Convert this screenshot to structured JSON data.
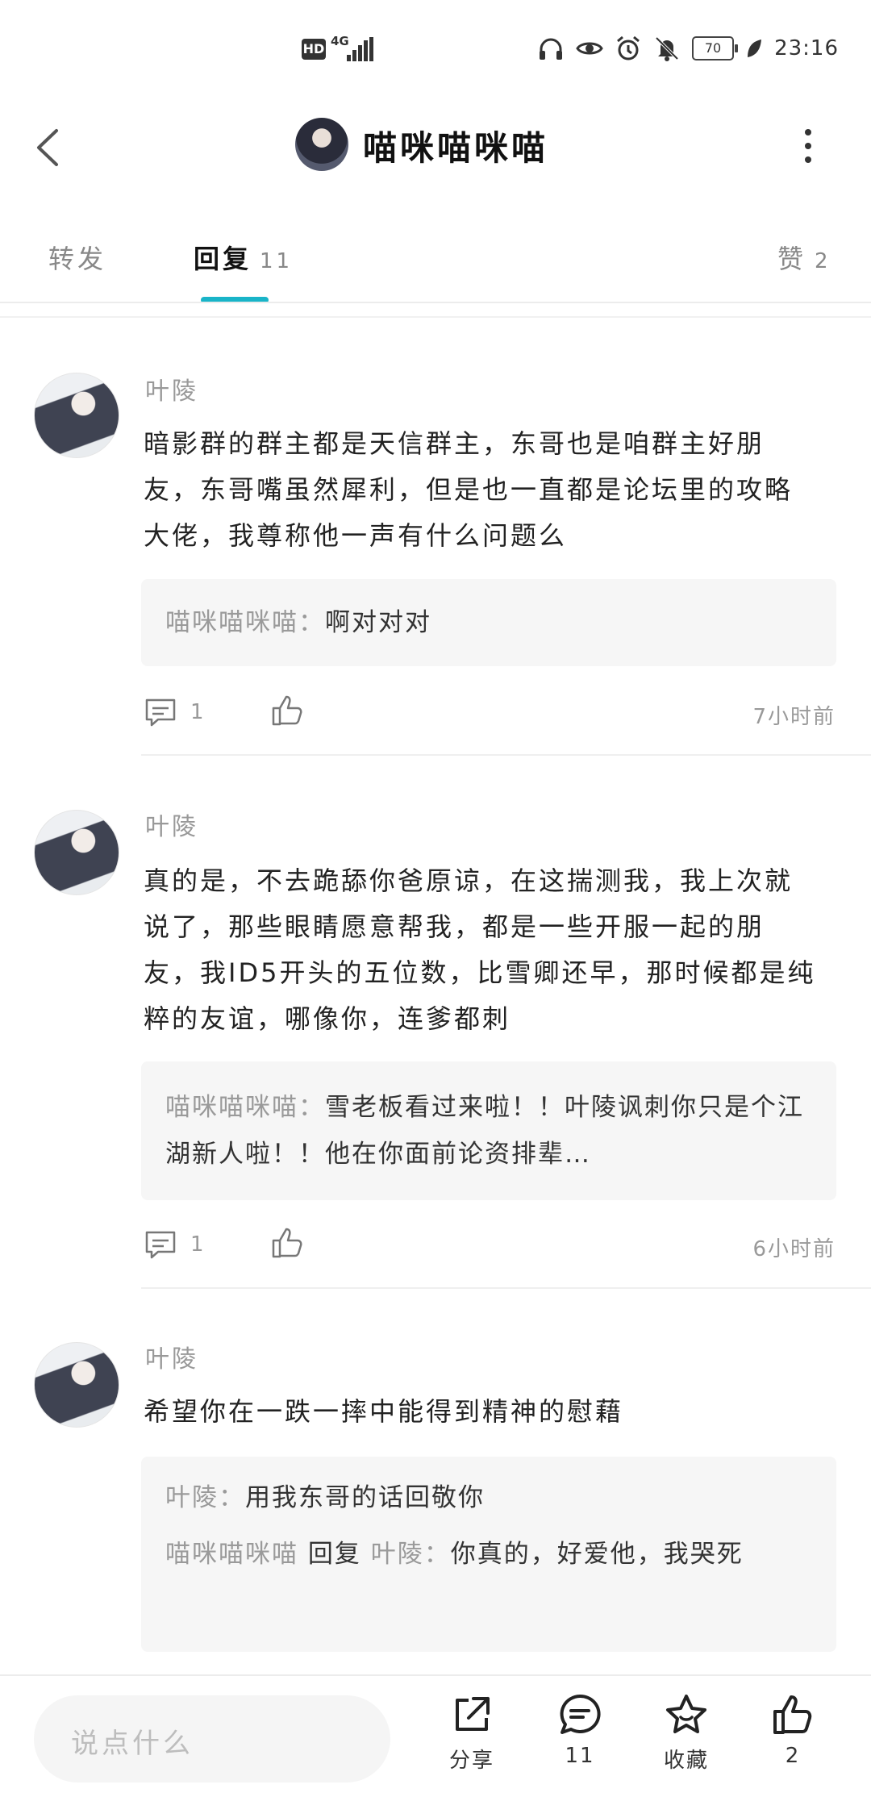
{
  "status_bar": {
    "hd": "HD",
    "network": "4G",
    "battery": "70",
    "time": "23:16"
  },
  "header": {
    "title": "喵咪喵咪喵"
  },
  "tabs": {
    "forward": {
      "label": "转发"
    },
    "reply": {
      "label": "回复",
      "count": "11"
    },
    "like": {
      "label": "赞",
      "count": "2"
    }
  },
  "comments": [
    {
      "username": "叶陵",
      "text": "暗影群的群主都是天信群主，东哥也是咱群主好朋友，东哥嘴虽然犀利，但是也一直都是论坛里的攻略大佬，我尊称他一声有什么问题么",
      "replies": [
        {
          "name": "喵咪喵咪喵",
          "sep": "：",
          "text": "啊对对对"
        }
      ],
      "reply_count": "1",
      "time": "7小时前"
    },
    {
      "username": "叶陵",
      "text": "真的是，不去跪舔你爸原谅，在这揣测我，我上次就说了，那些眼睛愿意帮我，都是一些开服一起的朋友，我ID5开头的五位数，比雪卿还早，那时候都是纯粹的友谊，哪像你，连爹都刺",
      "replies": [
        {
          "name": "喵咪喵咪喵",
          "sep": "：",
          "text": "雪老板看过来啦！！叶陵讽刺你只是个江湖新人啦！！他在你面前论资排辈…"
        }
      ],
      "reply_count": "1",
      "time": "6小时前"
    },
    {
      "username": "叶陵",
      "text": "希望你在一跌一摔中能得到精神的慰藉",
      "replies": [
        {
          "name": "叶陵",
          "sep": "：",
          "text": "用我东哥的话回敬你"
        },
        {
          "name": "喵咪喵咪喵",
          "mid": "回复",
          "target": "叶陵",
          "sep": "：",
          "text": "你真的，好爱他，我哭死"
        }
      ]
    }
  ],
  "bottom_bar": {
    "input_placeholder": "说点什么",
    "share_label": "分享",
    "comment_count": "11",
    "collect_label": "收藏",
    "like_count": "2"
  },
  "colors": {
    "accent": "#19b4c8"
  }
}
